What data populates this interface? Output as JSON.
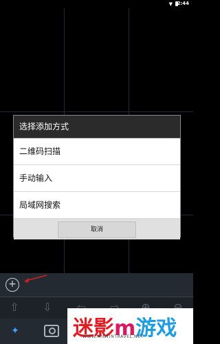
{
  "status_bar": {
    "time": "2:44"
  },
  "dialog": {
    "title": "选择添加方式",
    "options": [
      {
        "label": "二维码扫描"
      },
      {
        "label": "手动输入"
      },
      {
        "label": "局域网搜索"
      }
    ],
    "cancel_label": "取消"
  },
  "bottom_panel": {
    "add_icon": "plus-circle-icon",
    "controls": [
      "arrow-up-icon",
      "arrow-down-icon",
      "arrow-left-icon",
      "arrow-right-icon",
      "zoom-in-icon",
      "zoom-out-icon"
    ],
    "bottom_icons": [
      "dial-icon",
      "camera-icon"
    ]
  },
  "watermark": {
    "text_part1": "迷影",
    "text_part2": "m",
    "text_part3": "游戏",
    "url": "WWW.MINYINTRAVEL.NET"
  },
  "colors": {
    "dialog_header": "#2b2b2b",
    "dialog_body": "#ffffff",
    "panel_bg": "#1d2228",
    "watermark_red": "#e31c23",
    "watermark_blue": "#1f9de0",
    "arrow_red": "#cc2222"
  }
}
